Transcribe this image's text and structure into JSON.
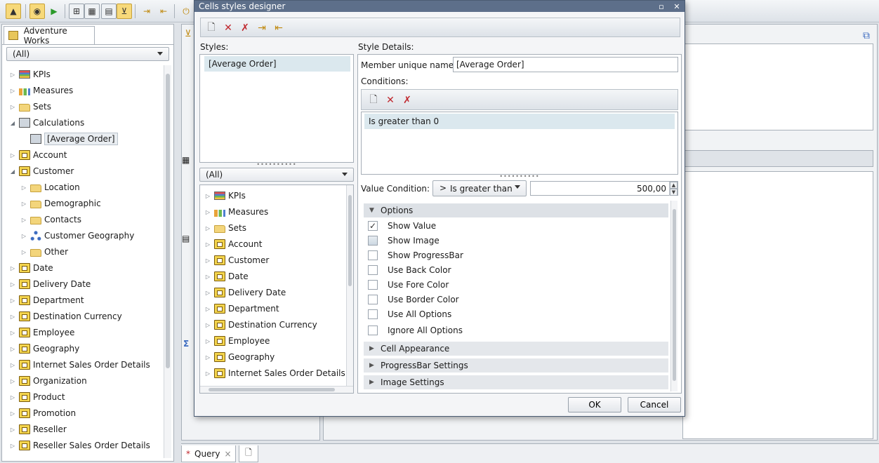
{
  "toolbar": {
    "buttons": [
      "pointer",
      "cube",
      "run",
      "design",
      "grid",
      "filter",
      "import",
      "export",
      "power"
    ]
  },
  "left_panel": {
    "tab_label": "Adventure Works",
    "filter_value": "(All)",
    "tree": [
      {
        "label": "KPIs",
        "icon": "kpi-icon",
        "level": 0,
        "expanded": false
      },
      {
        "label": "Measures",
        "icon": "measures-icon",
        "level": 0,
        "expanded": false
      },
      {
        "label": "Sets",
        "icon": "folder-icon",
        "level": 0,
        "expanded": false
      },
      {
        "label": "Calculations",
        "icon": "calculations-icon",
        "level": 0,
        "expanded": true
      },
      {
        "label": "[Average Order]",
        "icon": "calculated-member-icon",
        "level": 1,
        "selected": true
      },
      {
        "label": "Account",
        "icon": "dimension-icon",
        "level": 0,
        "expanded": false
      },
      {
        "label": "Customer",
        "icon": "dimension-icon",
        "level": 0,
        "expanded": true
      },
      {
        "label": "Location",
        "icon": "folder-icon",
        "level": 1,
        "expanded": false
      },
      {
        "label": "Demographic",
        "icon": "folder-icon",
        "level": 1,
        "expanded": false
      },
      {
        "label": "Contacts",
        "icon": "folder-icon",
        "level": 1,
        "expanded": false
      },
      {
        "label": "Customer Geography",
        "icon": "hierarchy-icon",
        "level": 1,
        "expanded": false
      },
      {
        "label": "Other",
        "icon": "folder-icon",
        "level": 1,
        "expanded": false
      },
      {
        "label": "Date",
        "icon": "dimension-icon",
        "level": 0,
        "expanded": false
      },
      {
        "label": "Delivery Date",
        "icon": "dimension-icon",
        "level": 0,
        "expanded": false
      },
      {
        "label": "Department",
        "icon": "dimension-icon",
        "level": 0,
        "expanded": false
      },
      {
        "label": "Destination Currency",
        "icon": "dimension-icon",
        "level": 0,
        "expanded": false
      },
      {
        "label": "Employee",
        "icon": "dimension-icon",
        "level": 0,
        "expanded": false
      },
      {
        "label": "Geography",
        "icon": "dimension-icon",
        "level": 0,
        "expanded": false
      },
      {
        "label": "Internet Sales Order Details",
        "icon": "dimension-icon",
        "level": 0,
        "expanded": false
      },
      {
        "label": "Organization",
        "icon": "dimension-icon",
        "level": 0,
        "expanded": false
      },
      {
        "label": "Product",
        "icon": "dimension-icon",
        "level": 0,
        "expanded": false
      },
      {
        "label": "Promotion",
        "icon": "dimension-icon",
        "level": 0,
        "expanded": false
      },
      {
        "label": "Reseller",
        "icon": "dimension-icon",
        "level": 0,
        "expanded": false
      },
      {
        "label": "Reseller Sales Order Details",
        "icon": "dimension-icon",
        "level": 0,
        "expanded": false
      }
    ]
  },
  "bottom_tabs": {
    "query_tab": {
      "modified_marker": "*",
      "label": "Query",
      "close": "×"
    }
  },
  "dialog": {
    "title": "Cells styles designer",
    "styles_label": "Styles:",
    "styles_list": [
      "[Average Order]"
    ],
    "filter_value": "(All)",
    "tree": [
      {
        "label": "KPIs",
        "icon": "kpi-icon"
      },
      {
        "label": "Measures",
        "icon": "measures-icon"
      },
      {
        "label": "Sets",
        "icon": "folder-icon"
      },
      {
        "label": "Account",
        "icon": "dimension-icon"
      },
      {
        "label": "Customer",
        "icon": "dimension-icon"
      },
      {
        "label": "Date",
        "icon": "dimension-icon"
      },
      {
        "label": "Delivery Date",
        "icon": "dimension-icon"
      },
      {
        "label": "Department",
        "icon": "dimension-icon"
      },
      {
        "label": "Destination Currency",
        "icon": "dimension-icon"
      },
      {
        "label": "Employee",
        "icon": "dimension-icon"
      },
      {
        "label": "Geography",
        "icon": "dimension-icon"
      },
      {
        "label": "Internet Sales Order Details",
        "icon": "dimension-icon"
      }
    ],
    "details": {
      "label": "Style Details:",
      "member_name_label": "Member unique name:",
      "member_name_value": "[Average Order]",
      "conditions_label": "Conditions:",
      "conditions": [
        "Is greater than 0"
      ],
      "value_condition_label": "Value Condition:",
      "value_condition_operator": "Is greater than",
      "value_condition_value": "500,00",
      "options_header": "Options",
      "options": [
        {
          "label": "Show Value",
          "checked": true
        },
        {
          "label": "Show Image",
          "checked": false,
          "indeterminate": true
        },
        {
          "label": "Show ProgressBar",
          "checked": false
        },
        {
          "label": "Use Back Color",
          "checked": false
        },
        {
          "label": "Use Fore Color",
          "checked": false
        },
        {
          "label": "Use Border Color",
          "checked": false
        },
        {
          "label": "Use All Options",
          "checked": false
        },
        {
          "label": "Ignore All Options",
          "checked": false
        }
      ],
      "sections": [
        "Cell Appearance",
        "ProgressBar Settings",
        "Image Settings"
      ]
    },
    "buttons": {
      "ok": "OK",
      "cancel": "Cancel"
    }
  },
  "colors": {
    "title_bar": "#5d6f8a",
    "selection": "#dbe8ee",
    "delete_red": "#c0272d"
  }
}
